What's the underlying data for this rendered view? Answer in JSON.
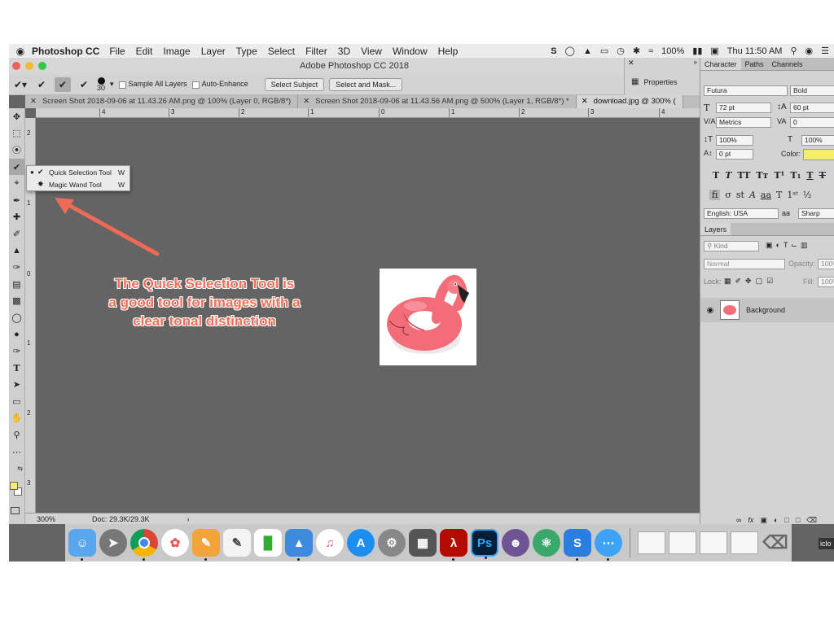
{
  "menubar": {
    "apple": "",
    "app_name": "Photoshop CC",
    "items": [
      "File",
      "Edit",
      "Image",
      "Layer",
      "Type",
      "Select",
      "Filter",
      "3D",
      "View",
      "Window",
      "Help"
    ],
    "battery": "100%",
    "clock": "Thu 11:50 AM"
  },
  "window": {
    "title": "Adobe Photoshop CC 2018"
  },
  "options_bar": {
    "brush_size": "30",
    "sample_all_layers": "Sample All Layers",
    "auto_enhance": "Auto-Enhance",
    "select_subject": "Select Subject",
    "select_and_mask": "Select and Mask..."
  },
  "properties_panel": {
    "label": "Properties"
  },
  "doc_tabs": [
    {
      "label": "Screen Shot 2018-09-06 at 11.43.26 AM.png @ 100% (Layer 0, RGB/8*)",
      "active": false
    },
    {
      "label": "Screen Shot 2018-09-06 at 11.43.56 AM.png @ 500% (Layer 1, RGB/8*) *",
      "active": false
    },
    {
      "label": "download.jpg @ 300% (",
      "active": true
    }
  ],
  "ruler_h": [
    "4",
    "3",
    "2",
    "1",
    "0",
    "1",
    "2",
    "3",
    "4"
  ],
  "ruler_v": [
    "2",
    "1",
    "0",
    "1",
    "2",
    "3"
  ],
  "flyout": {
    "items": [
      {
        "label": "Quick Selection Tool",
        "key": "W"
      },
      {
        "label": "Magic Wand Tool",
        "key": "W"
      }
    ]
  },
  "callout": {
    "lines": [
      "The Quick Selection Tool is",
      "a good tool for images with a",
      "clear tonal distinction"
    ]
  },
  "status": {
    "zoom": "300%",
    "doc": "Doc: 29.3K/29.3K"
  },
  "character_panel": {
    "tabs": [
      "Character",
      "Paths",
      "Channels"
    ],
    "font_family": "Futura",
    "font_style": "Bold",
    "font_size": "72 pt",
    "leading": "60 pt",
    "kerning": "Metrics",
    "tracking": "0",
    "vscale": "100%",
    "hscale": "100%",
    "baseline": "0 pt",
    "color_label": "Color:",
    "color": "#f4ee6a",
    "language": "English: USA",
    "aa_label": "a",
    "antialias": "Sharp"
  },
  "layers_panel": {
    "tab": "Layers",
    "kind": "Kind",
    "blend": "Normal",
    "opacity_label": "Opacity:",
    "opacity": "100%",
    "lock_label": "Lock:",
    "fill_label": "Fill:",
    "fill": "100%",
    "layer_name": "Background"
  },
  "dock": {
    "ps_label": "Ps",
    "icloud_label": "iclo"
  }
}
